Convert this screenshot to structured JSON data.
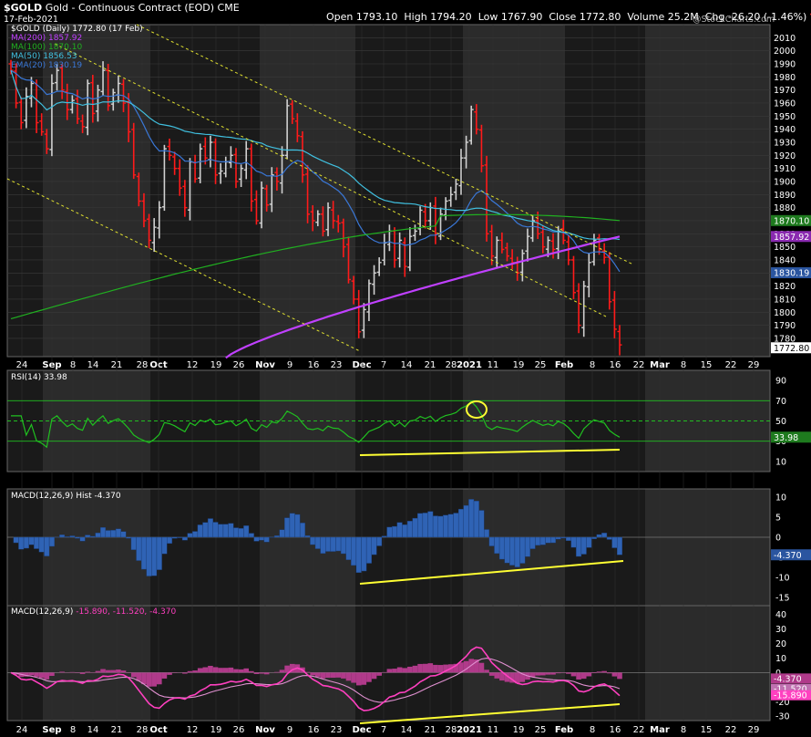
{
  "header": {
    "symbol": "$GOLD",
    "description": "Gold - Continuous Contract (EOD)",
    "exchange": "CME",
    "date": "17-Feb-2021",
    "open_label": "Open",
    "open": "1793.10",
    "high_label": "High",
    "high": "1794.20",
    "low_label": "Low",
    "low": "1767.90",
    "close_label": "Close",
    "close": "1772.80",
    "volume_label": "Volume",
    "volume": "25.2M",
    "chg_label": "Chg",
    "chg": "-26.20 (-1.46%)",
    "chg_arrow": "▼",
    "watermark": "@StockCharts.com"
  },
  "colors": {
    "up": "#d0d0d0",
    "down": "#ff1a1a",
    "ma200": "#c040ff",
    "ma100": "#20b020",
    "ma50": "#40c0e0",
    "ema20": "#3a78d8",
    "rsi": "#20c020",
    "macd_hist": "#2f63b5",
    "macd_line": "#ff40c0",
    "macd_signal": "#e090d0",
    "annot": "#ffff33",
    "channel": "#e0e030"
  },
  "legend": {
    "price_title": "$GOLD (Daily) 1772.80 (17 Feb)",
    "ma200": "MA(200) 1857.92",
    "ma100": "MA(100) 1870.10",
    "ma50": "MA(50) 1856.53",
    "ema20": "EMA(20) 1830.19",
    "rsi": "RSI(14) 33.98",
    "macd_hist": "MACD(12,26,9) Hist -4.370",
    "macd": "MACD(12,26,9)",
    "macd_vals": "-15.890, -11.520, -4.370"
  },
  "price_tags": {
    "ma100": "1870.10",
    "ma200": "1857.92",
    "ema20": "1830.19",
    "last": "1772.80"
  },
  "rsi_tag": "33.98",
  "macdh_tag": "-4.370",
  "macd_tags": [
    "-4.370",
    "-11.520",
    "-15.890"
  ],
  "x_labels": [
    "24",
    "Sep",
    "8",
    "14",
    "21",
    "28",
    "Oct",
    "12",
    "19",
    "26",
    "Nov",
    "9",
    "16",
    "23",
    "Dec",
    "7",
    "14",
    "21",
    "28",
    "2021",
    "11",
    "19",
    "25",
    "Feb",
    "8",
    "16",
    "22",
    "Mar",
    "8",
    "15",
    "22",
    "29"
  ],
  "x_bold": [
    "Sep",
    "Oct",
    "Nov",
    "Dec",
    "2021",
    "Feb",
    "Mar"
  ],
  "chart_data": {
    "type": "bar",
    "price": {
      "axis_ticks": [
        1780,
        1790,
        1800,
        1810,
        1820,
        1830,
        1840,
        1850,
        1860,
        1870,
        1880,
        1890,
        1900,
        1910,
        1920,
        1930,
        1940,
        1950,
        1960,
        1970,
        1980,
        1990,
        2000,
        2010
      ],
      "ylim": [
        1766,
        2020
      ],
      "ohlc_close": [
        1985,
        1960,
        1945,
        1965,
        1975,
        1945,
        1938,
        1925,
        1975,
        1985,
        1970,
        1955,
        1962,
        1948,
        1942,
        1975,
        1952,
        1970,
        1985,
        1958,
        1968,
        1975,
        1960,
        1938,
        1905,
        1885,
        1870,
        1855,
        1865,
        1880,
        1925,
        1920,
        1910,
        1895,
        1880,
        1915,
        1902,
        1925,
        1918,
        1930,
        1905,
        1908,
        1915,
        1920,
        1900,
        1910,
        1925,
        1885,
        1870,
        1895,
        1882,
        1905,
        1900,
        1920,
        1958,
        1948,
        1935,
        1905,
        1875,
        1870,
        1875,
        1862,
        1880,
        1870,
        1868,
        1850,
        1825,
        1810,
        1785,
        1802,
        1822,
        1830,
        1838,
        1853,
        1862,
        1840,
        1855,
        1835,
        1858,
        1862,
        1878,
        1870,
        1880,
        1860,
        1875,
        1885,
        1890,
        1898,
        1918,
        1930,
        1955,
        1940,
        1912,
        1860,
        1843,
        1855,
        1848,
        1843,
        1838,
        1830,
        1845,
        1858,
        1870,
        1860,
        1850,
        1855,
        1848,
        1862,
        1855,
        1840,
        1815,
        1790,
        1820,
        1838,
        1855,
        1848,
        1842,
        1808,
        1787,
        1775
      ],
      "ma200": {
        "name": "MA(200)",
        "start": 1765,
        "end": 1857.92
      },
      "ma100": {
        "name": "MA(100)",
        "start": 1795,
        "end": 1870.1
      },
      "ma50": {
        "name": "MA(50)",
        "end": 1856.53
      },
      "ema20": {
        "name": "EMA(20)",
        "end": 1830.19
      }
    },
    "rsi": {
      "axis_ticks": [
        10,
        30,
        50,
        70,
        90
      ],
      "ylim": [
        0,
        100
      ],
      "levels": [
        30,
        50,
        70
      ],
      "last": 33.98
    },
    "macd_hist": {
      "axis_ticks": [
        -15,
        -10,
        -5,
        0,
        5,
        10
      ],
      "ylim": [
        -17,
        12
      ],
      "last": -4.37
    },
    "macd": {
      "axis_ticks": [
        -30,
        -20,
        -10,
        0,
        10,
        20,
        30,
        40
      ],
      "ylim": [
        -33,
        46
      ],
      "macd_last": -15.89,
      "signal_last": -11.52,
      "hist_last": -4.37
    }
  }
}
